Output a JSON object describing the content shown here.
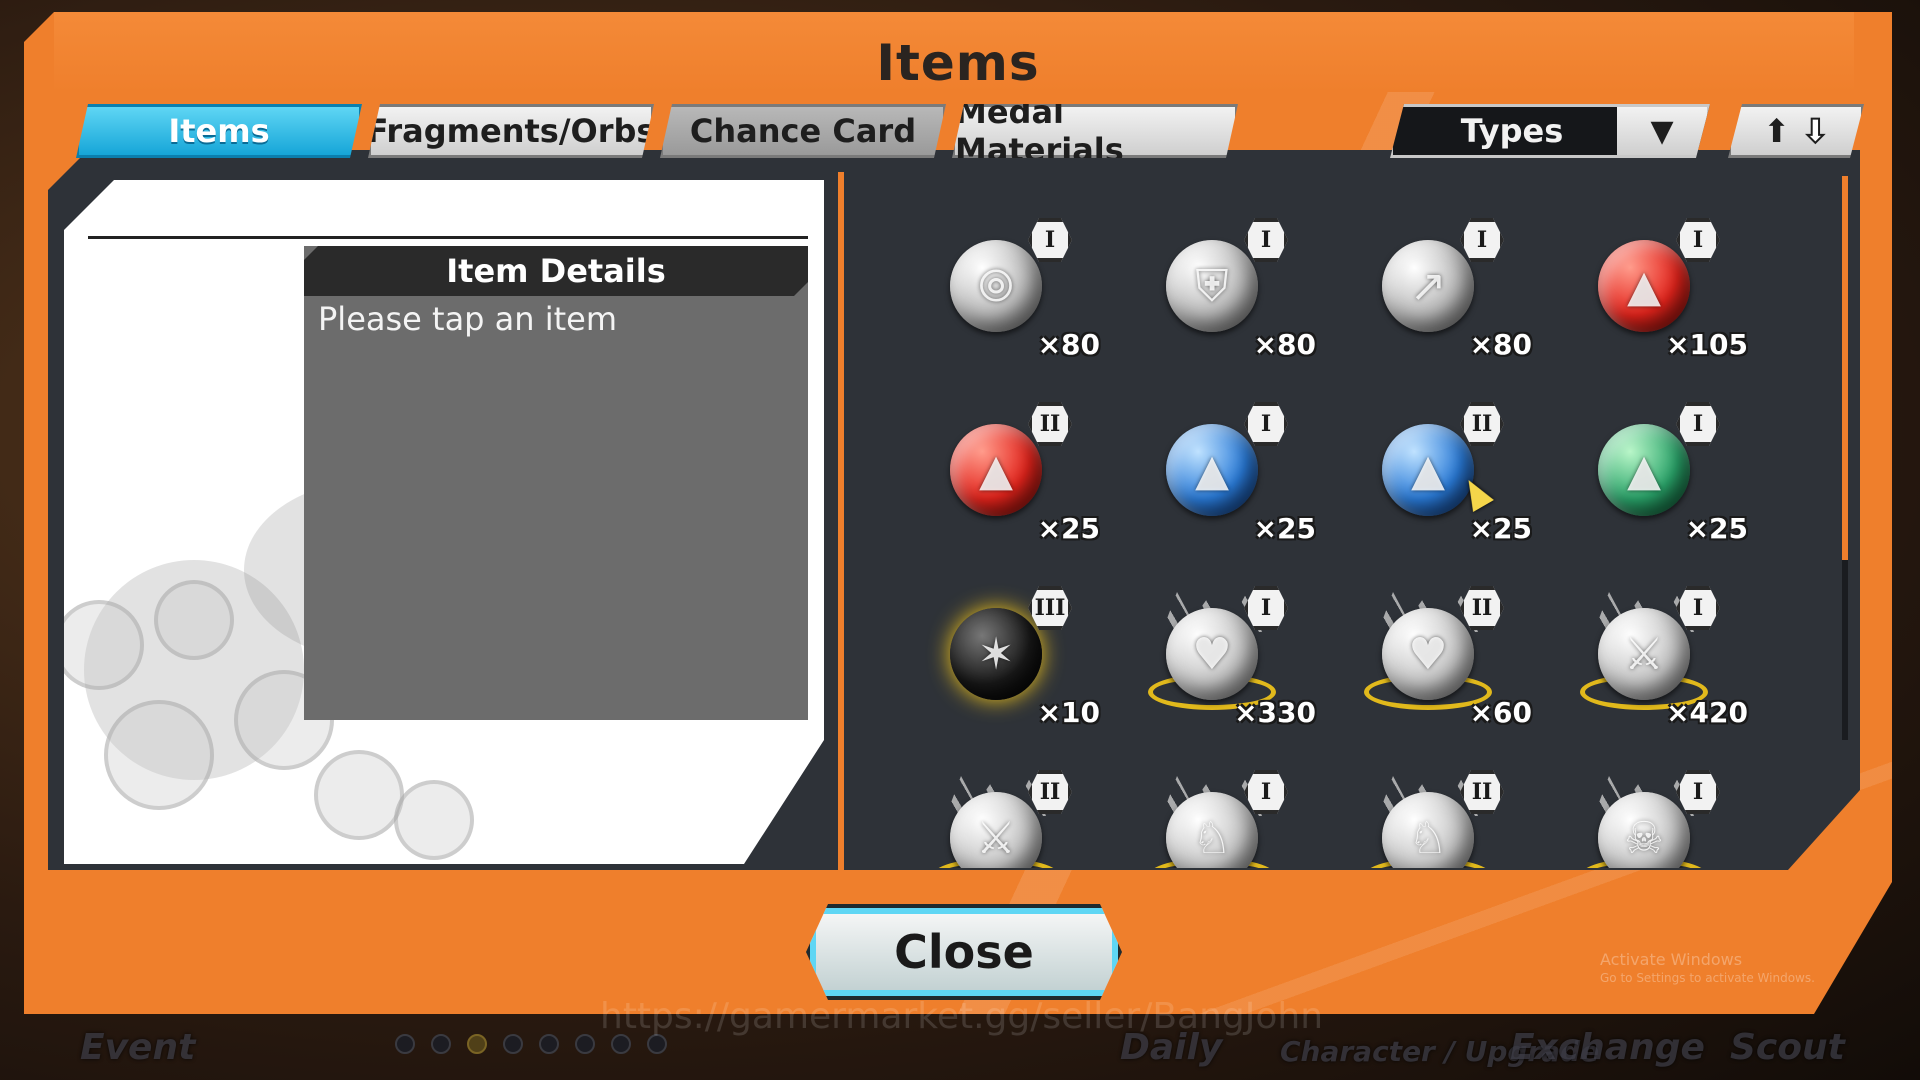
{
  "window": {
    "title": "Items"
  },
  "tabs": [
    {
      "label": "Items",
      "active": true
    },
    {
      "label": "Fragments/Orbs",
      "active": false
    },
    {
      "label": "Chance Card",
      "active": false
    },
    {
      "label": "Medal Materials",
      "active": false
    }
  ],
  "filter": {
    "label": "Types",
    "dropdown_icon": "triangle-down-icon"
  },
  "sort": {
    "icons": [
      "arrow-up-icon",
      "arrow-down-icon"
    ]
  },
  "details": {
    "header": "Item Details",
    "text": "Please tap an item"
  },
  "items": [
    {
      "icon": "silver-skill-orb-icon",
      "kind": "silver",
      "glyph": "⦾",
      "tier": "I",
      "qty": "×80"
    },
    {
      "icon": "silver-shield-orb-icon",
      "kind": "silver",
      "glyph": "⛨",
      "tier": "I",
      "qty": "×80"
    },
    {
      "icon": "silver-boot-orb-icon",
      "kind": "silver",
      "glyph": "↗",
      "tier": "I",
      "qty": "×80"
    },
    {
      "icon": "red-orb-icon",
      "kind": "red",
      "glyph": "▲",
      "tier": "I",
      "qty": "×105"
    },
    {
      "icon": "red-orb-icon",
      "kind": "red",
      "glyph": "▲",
      "tier": "II",
      "qty": "×25"
    },
    {
      "icon": "blue-orb-icon",
      "kind": "blue",
      "glyph": "▲",
      "tier": "I",
      "qty": "×25"
    },
    {
      "icon": "blue-orb-icon",
      "kind": "blue",
      "glyph": "▲",
      "tier": "II",
      "qty": "×25"
    },
    {
      "icon": "green-orb-icon",
      "kind": "green",
      "glyph": "▲",
      "tier": "I",
      "qty": "×25"
    },
    {
      "icon": "black-spark-orb-icon",
      "kind": "black",
      "glyph": "✶",
      "tier": "III",
      "qty": "×10"
    },
    {
      "icon": "heart-medal-icon",
      "kind": "medal",
      "glyph": "♥",
      "tier": "I",
      "qty": "×330"
    },
    {
      "icon": "heart-medal-icon",
      "kind": "medal",
      "glyph": "♥",
      "tier": "II",
      "qty": "×60"
    },
    {
      "icon": "sword-medal-icon",
      "kind": "medal",
      "glyph": "⚔",
      "tier": "I",
      "qty": "×420"
    },
    {
      "icon": "sword-medal-icon",
      "kind": "medal",
      "glyph": "⚔",
      "tier": "II",
      "qty": ""
    },
    {
      "icon": "armor-medal-icon",
      "kind": "medal",
      "glyph": "♘",
      "tier": "I",
      "qty": ""
    },
    {
      "icon": "armor-medal-icon",
      "kind": "medal",
      "glyph": "♘",
      "tier": "II",
      "qty": ""
    },
    {
      "icon": "skull-medal-icon",
      "kind": "medal",
      "glyph": "☠",
      "tier": "I",
      "qty": ""
    }
  ],
  "close_label": "Close",
  "bottom_nav": [
    "Event",
    "Daily",
    "Character / Upgrade",
    "Exchange",
    "Scout"
  ],
  "watermark": "https://gamermarket.gg/seller/BangJohn",
  "os_notice": {
    "title": "Activate Windows",
    "subtitle": "Go to Settings to activate Windows."
  },
  "colors": {
    "accent": "#ef7f2c",
    "tab_active": "#16a6d8",
    "panel": "#2e3238"
  }
}
